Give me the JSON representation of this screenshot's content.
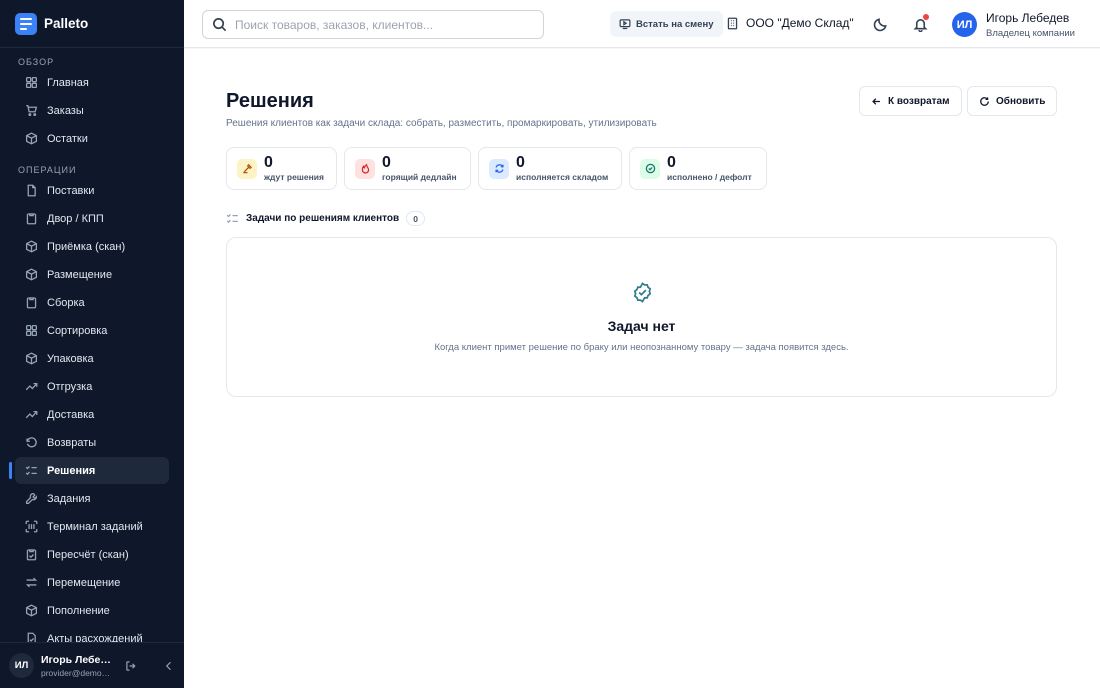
{
  "brand": {
    "name": "Palleto"
  },
  "sidebar": {
    "sections": [
      {
        "label": "ОБЗОР",
        "items": [
          "Главная",
          "Заказы",
          "Остатки"
        ]
      },
      {
        "label": "ОПЕРАЦИИ",
        "items": [
          "Поставки",
          "Двор / КПП",
          "Приёмка (скан)",
          "Размещение",
          "Сборка",
          "Сортировка",
          "Упаковка",
          "Отгрузка",
          "Доставка",
          "Возвраты",
          "Решения",
          "Задания",
          "Терминал заданий",
          "Пересчёт (скан)",
          "Перемещение",
          "Пополнение",
          "Акты расхождений"
        ]
      }
    ],
    "active_item": "Решения",
    "footer": {
      "initials": "ИЛ",
      "name": "Игорь Лебедев",
      "email": "provider@demo.palleto.ru"
    }
  },
  "topbar": {
    "search_placeholder": "Поиск товаров, заказов, клиентов...",
    "shift_button": "Встать на смену",
    "company": "ООО \"Демо Склад\"",
    "user": {
      "initials": "ИЛ",
      "name": "Игорь Лебедев",
      "role": "Владелец компании"
    }
  },
  "page": {
    "title": "Решения",
    "subtitle": "Решения клиентов как задачи склада: собрать, разместить, промаркировать, утилизировать",
    "back_button": "К возвратам",
    "refresh_button": "Обновить"
  },
  "stats": [
    {
      "value": "0",
      "label": "ждут решения",
      "icon": "gavel-icon",
      "color": "#b45309",
      "bg": "#fef3c7"
    },
    {
      "value": "0",
      "label": "горящий дедлайн",
      "icon": "flame-icon",
      "color": "#dc2626",
      "bg": "#fee2e2"
    },
    {
      "value": "0",
      "label": "исполняется складом",
      "icon": "refresh-icon",
      "color": "#2563eb",
      "bg": "#dbeafe"
    },
    {
      "value": "0",
      "label": "исполнено / дефолт",
      "icon": "check-circle-icon",
      "color": "#0f766e",
      "bg": "#dcfce7"
    }
  ],
  "tasks": {
    "header": "Задачи по решениям клиентов",
    "count": "0",
    "empty_title": "Задач нет",
    "empty_text": "Когда клиент примет решение по браку или неопознанному товару — задача появится здесь."
  }
}
